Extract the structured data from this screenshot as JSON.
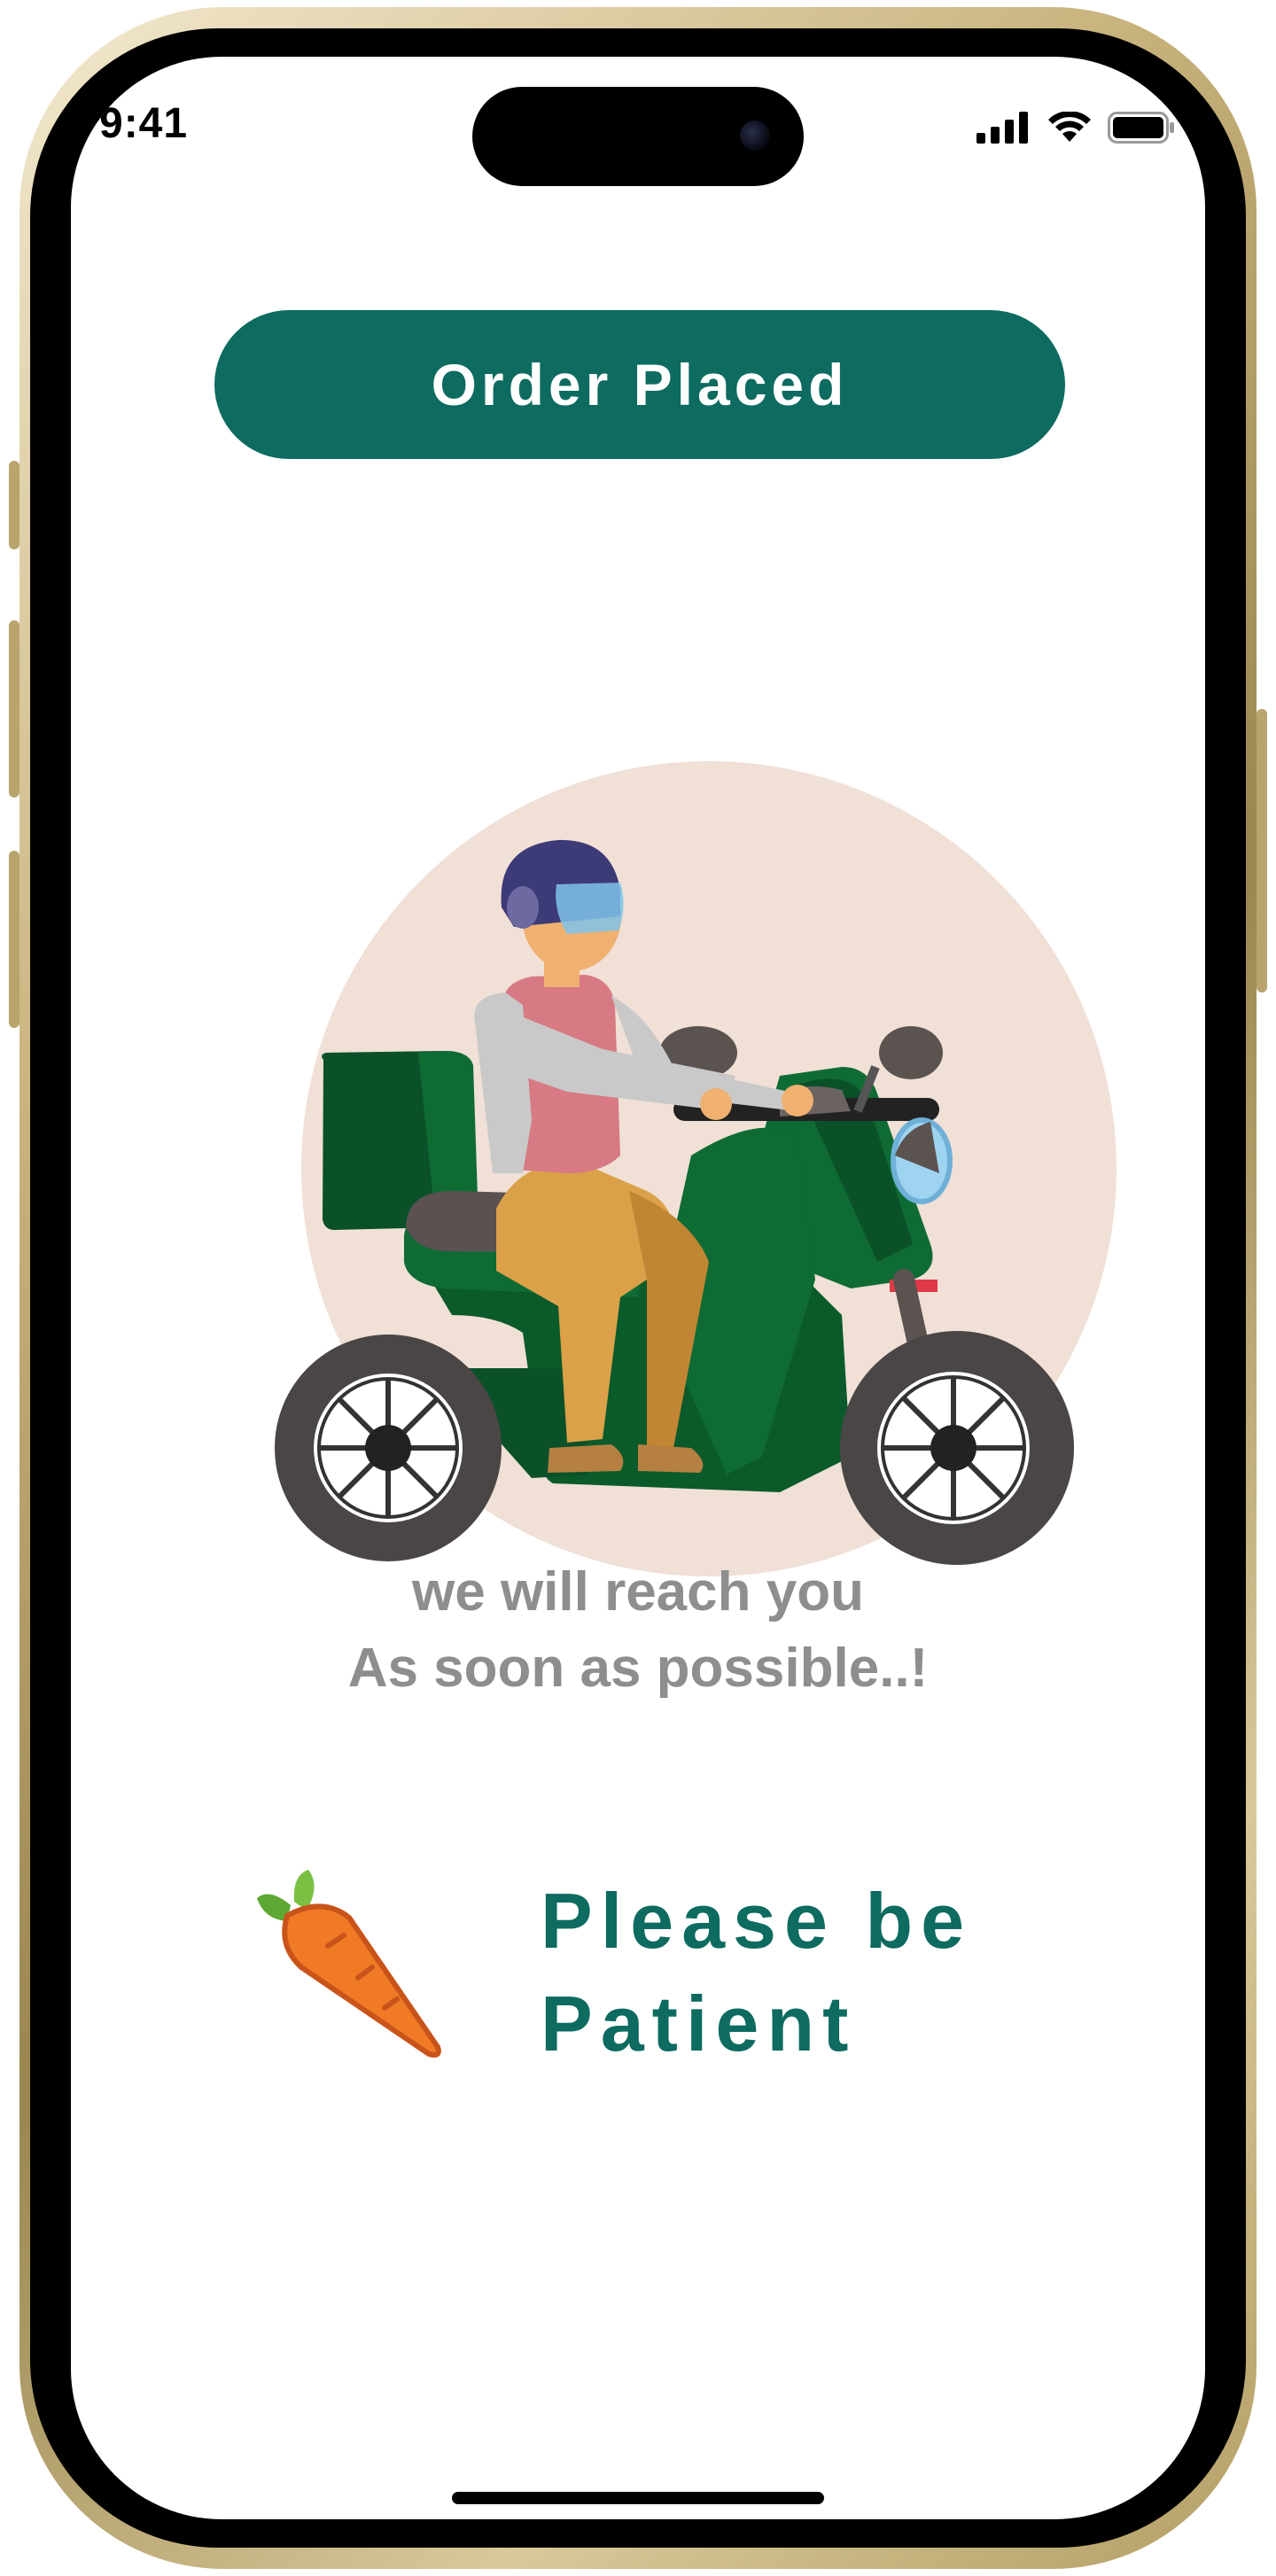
{
  "status_bar": {
    "time": "9:41",
    "icons": [
      "cellular-signal-icon",
      "wifi-icon",
      "battery-icon"
    ]
  },
  "header": {
    "order_status": "Order Placed"
  },
  "illustration": {
    "name": "delivery-scooter-illustration"
  },
  "message": {
    "line1": "we will reach you",
    "line2": "As soon as possible..!"
  },
  "patience": {
    "icon": "carrot-icon",
    "line1": "Please be",
    "line2": "Patient"
  },
  "colors": {
    "brand": "#0d6b60",
    "muted_text": "#8e8e8e",
    "illustration_bg": "#f0e0d6"
  }
}
